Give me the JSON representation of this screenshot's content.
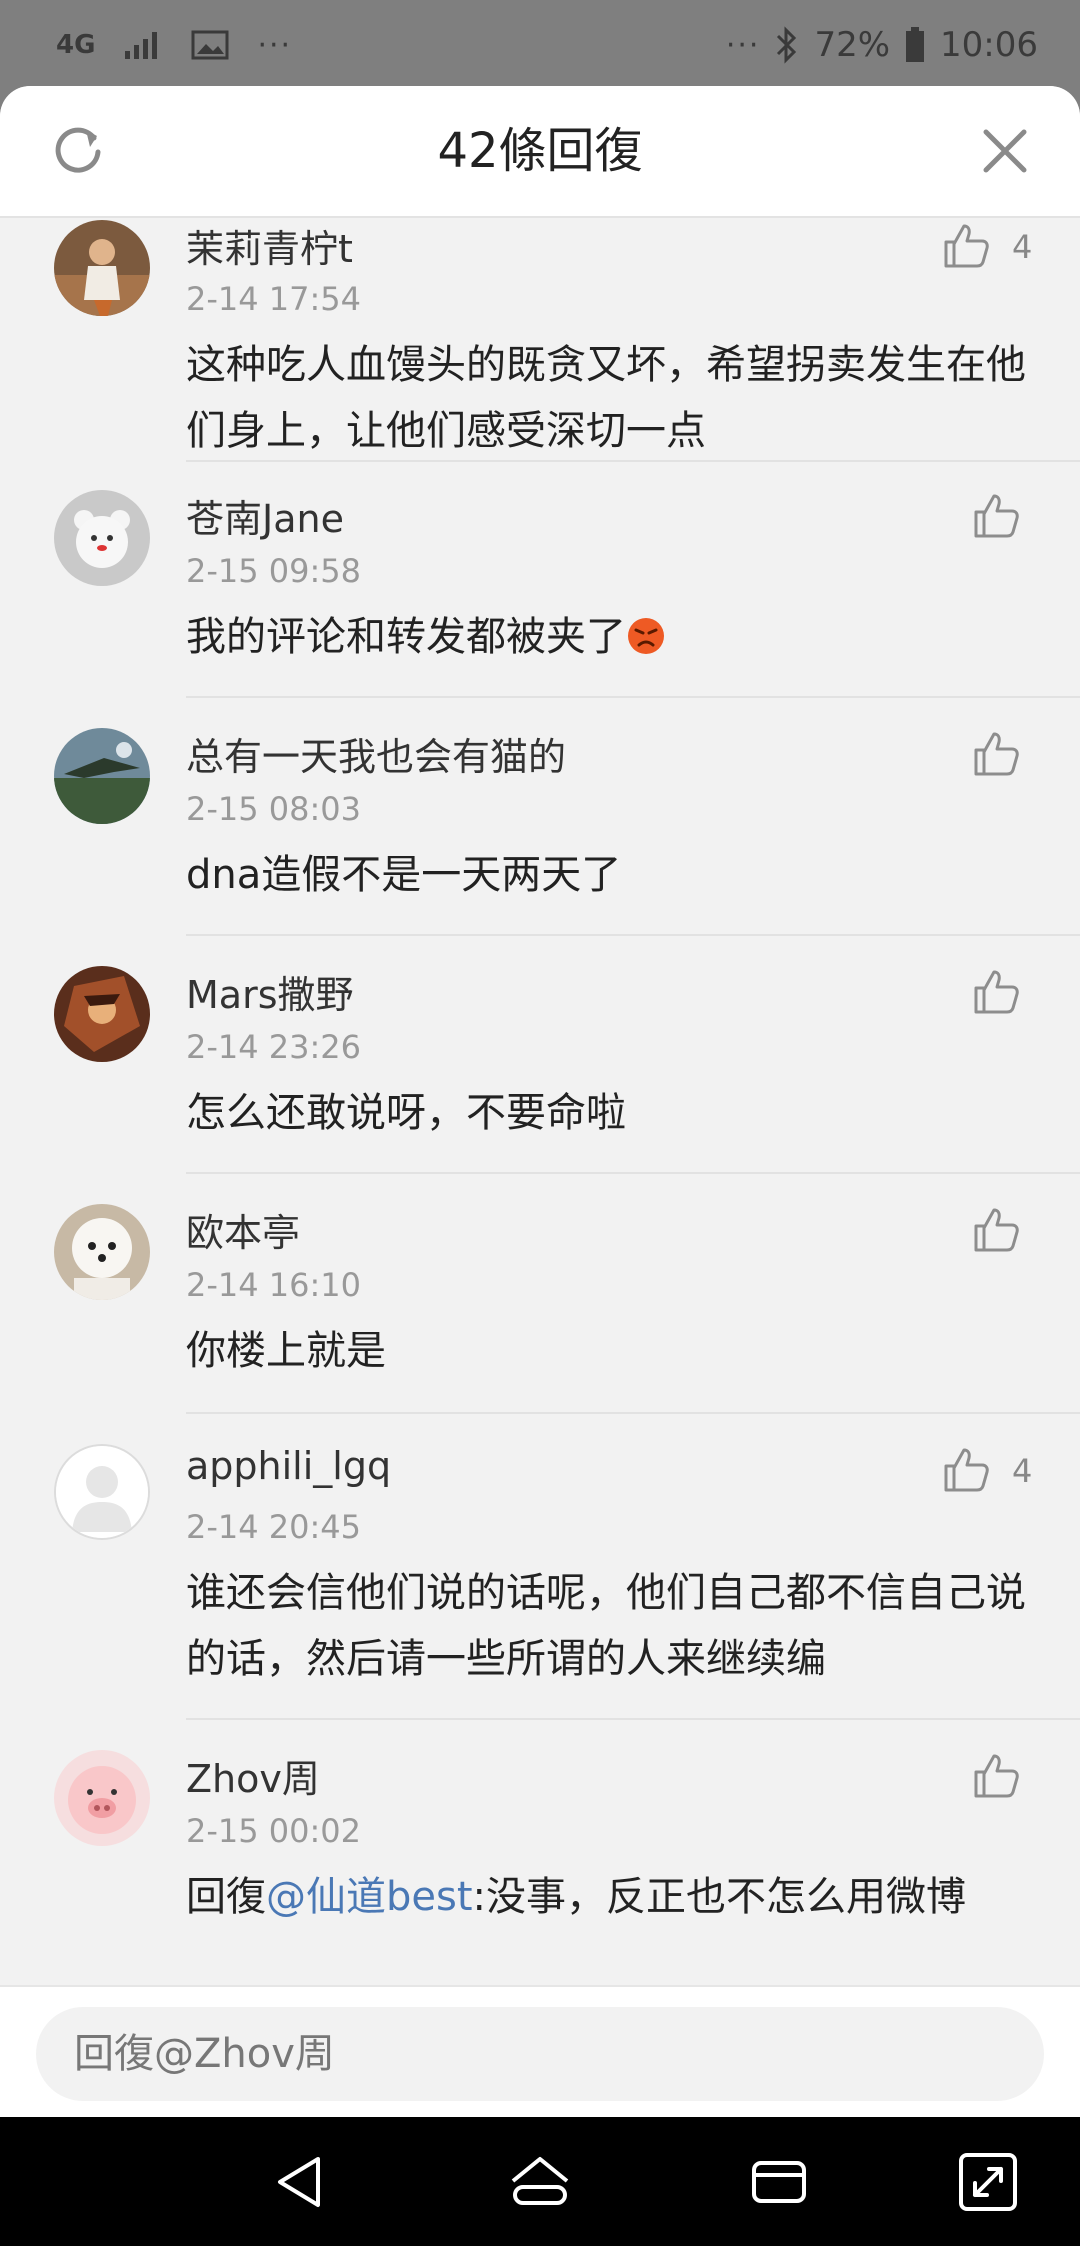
{
  "status_bar": {
    "network": "4G",
    "ellipsis": "···",
    "battery": "72%",
    "time": "10:06",
    "icons": [
      "network-4g-icon",
      "signal-icon",
      "image-icon",
      "more-icon",
      "bluetooth-icon",
      "battery-icon"
    ]
  },
  "header": {
    "title": "42條回復",
    "left_icon": "refresh-icon",
    "right_icon": "close-icon"
  },
  "comments": [
    {
      "username": "茉莉青柠t",
      "time": "2-14 17:54",
      "text": "这种吃人血馒头的既贪又坏，希望拐卖发生在他们身上，让他们感受深切一点",
      "likes": "4",
      "avatar": "avatar-woman"
    },
    {
      "username": "苍南Jane",
      "time": "2-15 09:58",
      "text": "我的评论和转发都被夹了",
      "emoji": "angry-face-emoji",
      "avatar": "avatar-bear"
    },
    {
      "username": "总有一天我也会有猫的",
      "time": "2-15 08:03",
      "text": "dna造假不是一天两天了",
      "avatar": "avatar-landscape"
    },
    {
      "username": "Mars撒野",
      "time": "2-14 23:26",
      "text": "怎么还敢说呀，不要命啦",
      "avatar": "avatar-anime"
    },
    {
      "username": "欧本亭",
      "time": "2-14 16:10",
      "text": "你楼上就是",
      "avatar": "avatar-dog"
    },
    {
      "username": "apphili_lgq",
      "time": "2-14 20:45",
      "text": "谁还会信他们说的话呢，他们自己都不信自己说的话，然后请一些所谓的人来继续编",
      "likes": "4",
      "avatar": "avatar-default"
    },
    {
      "username": "Zhov周",
      "time": "2-15 00:02",
      "reply_prefix": "回復",
      "mention": "@仙道best",
      "text": ":没事，反正也不怎么用微博",
      "avatar": "avatar-pig"
    }
  ],
  "reply_bar": {
    "placeholder": "回復@Zhov周"
  },
  "nav_bar": {
    "icons": [
      "back-icon",
      "home-icon",
      "recents-icon",
      "expand-icon"
    ]
  },
  "colors": {
    "mention": "#4a78b5",
    "background": "#f2f2f2",
    "status_bar": "#7f7f7f"
  }
}
